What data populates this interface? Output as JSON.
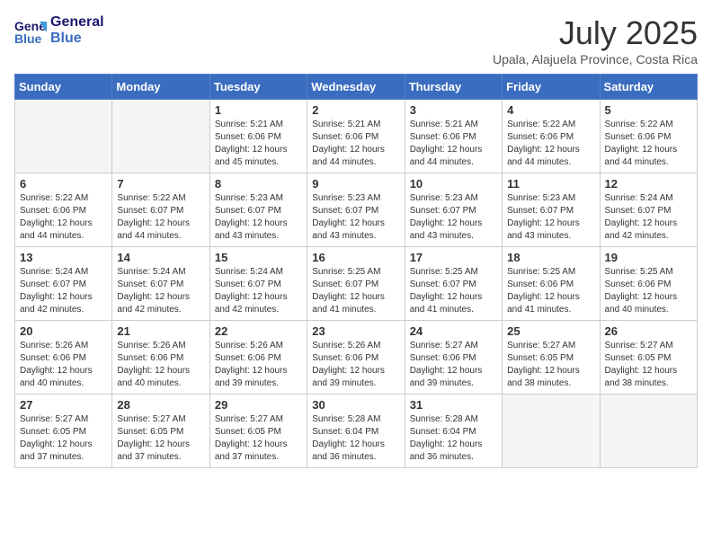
{
  "logo": {
    "line1": "General",
    "line2": "Blue"
  },
  "title": "July 2025",
  "location": "Upala, Alajuela Province, Costa Rica",
  "days_of_week": [
    "Sunday",
    "Monday",
    "Tuesday",
    "Wednesday",
    "Thursday",
    "Friday",
    "Saturday"
  ],
  "weeks": [
    [
      {
        "day": "",
        "info": ""
      },
      {
        "day": "",
        "info": ""
      },
      {
        "day": "1",
        "info": "Sunrise: 5:21 AM\nSunset: 6:06 PM\nDaylight: 12 hours\nand 45 minutes."
      },
      {
        "day": "2",
        "info": "Sunrise: 5:21 AM\nSunset: 6:06 PM\nDaylight: 12 hours\nand 44 minutes."
      },
      {
        "day": "3",
        "info": "Sunrise: 5:21 AM\nSunset: 6:06 PM\nDaylight: 12 hours\nand 44 minutes."
      },
      {
        "day": "4",
        "info": "Sunrise: 5:22 AM\nSunset: 6:06 PM\nDaylight: 12 hours\nand 44 minutes."
      },
      {
        "day": "5",
        "info": "Sunrise: 5:22 AM\nSunset: 6:06 PM\nDaylight: 12 hours\nand 44 minutes."
      }
    ],
    [
      {
        "day": "6",
        "info": "Sunrise: 5:22 AM\nSunset: 6:06 PM\nDaylight: 12 hours\nand 44 minutes."
      },
      {
        "day": "7",
        "info": "Sunrise: 5:22 AM\nSunset: 6:07 PM\nDaylight: 12 hours\nand 44 minutes."
      },
      {
        "day": "8",
        "info": "Sunrise: 5:23 AM\nSunset: 6:07 PM\nDaylight: 12 hours\nand 43 minutes."
      },
      {
        "day": "9",
        "info": "Sunrise: 5:23 AM\nSunset: 6:07 PM\nDaylight: 12 hours\nand 43 minutes."
      },
      {
        "day": "10",
        "info": "Sunrise: 5:23 AM\nSunset: 6:07 PM\nDaylight: 12 hours\nand 43 minutes."
      },
      {
        "day": "11",
        "info": "Sunrise: 5:23 AM\nSunset: 6:07 PM\nDaylight: 12 hours\nand 43 minutes."
      },
      {
        "day": "12",
        "info": "Sunrise: 5:24 AM\nSunset: 6:07 PM\nDaylight: 12 hours\nand 42 minutes."
      }
    ],
    [
      {
        "day": "13",
        "info": "Sunrise: 5:24 AM\nSunset: 6:07 PM\nDaylight: 12 hours\nand 42 minutes."
      },
      {
        "day": "14",
        "info": "Sunrise: 5:24 AM\nSunset: 6:07 PM\nDaylight: 12 hours\nand 42 minutes."
      },
      {
        "day": "15",
        "info": "Sunrise: 5:24 AM\nSunset: 6:07 PM\nDaylight: 12 hours\nand 42 minutes."
      },
      {
        "day": "16",
        "info": "Sunrise: 5:25 AM\nSunset: 6:07 PM\nDaylight: 12 hours\nand 41 minutes."
      },
      {
        "day": "17",
        "info": "Sunrise: 5:25 AM\nSunset: 6:07 PM\nDaylight: 12 hours\nand 41 minutes."
      },
      {
        "day": "18",
        "info": "Sunrise: 5:25 AM\nSunset: 6:06 PM\nDaylight: 12 hours\nand 41 minutes."
      },
      {
        "day": "19",
        "info": "Sunrise: 5:25 AM\nSunset: 6:06 PM\nDaylight: 12 hours\nand 40 minutes."
      }
    ],
    [
      {
        "day": "20",
        "info": "Sunrise: 5:26 AM\nSunset: 6:06 PM\nDaylight: 12 hours\nand 40 minutes."
      },
      {
        "day": "21",
        "info": "Sunrise: 5:26 AM\nSunset: 6:06 PM\nDaylight: 12 hours\nand 40 minutes."
      },
      {
        "day": "22",
        "info": "Sunrise: 5:26 AM\nSunset: 6:06 PM\nDaylight: 12 hours\nand 39 minutes."
      },
      {
        "day": "23",
        "info": "Sunrise: 5:26 AM\nSunset: 6:06 PM\nDaylight: 12 hours\nand 39 minutes."
      },
      {
        "day": "24",
        "info": "Sunrise: 5:27 AM\nSunset: 6:06 PM\nDaylight: 12 hours\nand 39 minutes."
      },
      {
        "day": "25",
        "info": "Sunrise: 5:27 AM\nSunset: 6:05 PM\nDaylight: 12 hours\nand 38 minutes."
      },
      {
        "day": "26",
        "info": "Sunrise: 5:27 AM\nSunset: 6:05 PM\nDaylight: 12 hours\nand 38 minutes."
      }
    ],
    [
      {
        "day": "27",
        "info": "Sunrise: 5:27 AM\nSunset: 6:05 PM\nDaylight: 12 hours\nand 37 minutes."
      },
      {
        "day": "28",
        "info": "Sunrise: 5:27 AM\nSunset: 6:05 PM\nDaylight: 12 hours\nand 37 minutes."
      },
      {
        "day": "29",
        "info": "Sunrise: 5:27 AM\nSunset: 6:05 PM\nDaylight: 12 hours\nand 37 minutes."
      },
      {
        "day": "30",
        "info": "Sunrise: 5:28 AM\nSunset: 6:04 PM\nDaylight: 12 hours\nand 36 minutes."
      },
      {
        "day": "31",
        "info": "Sunrise: 5:28 AM\nSunset: 6:04 PM\nDaylight: 12 hours\nand 36 minutes."
      },
      {
        "day": "",
        "info": ""
      },
      {
        "day": "",
        "info": ""
      }
    ]
  ]
}
